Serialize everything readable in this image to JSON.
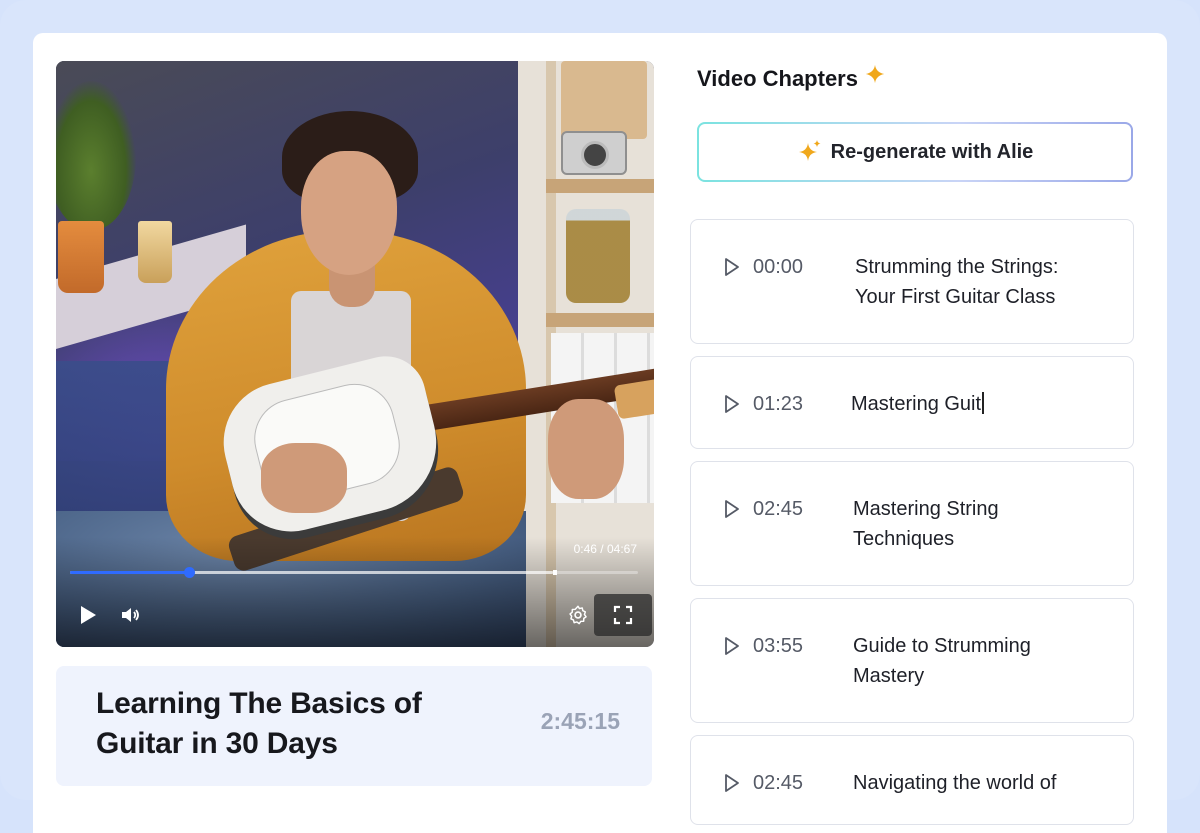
{
  "player": {
    "time_readout": "0:46 / 04:67",
    "progress_fraction": 0.21,
    "buffered_fraction": 0.85
  },
  "video": {
    "title": "Learning The Basics of Guitar in 30 Days",
    "duration": "2:45:15"
  },
  "chapters_panel": {
    "title": "Video Chapters",
    "regenerate_label": "Re-generate with Alie",
    "chapters": [
      {
        "time": "00:00",
        "title": "Strumming the Strings: Your First Guitar Class"
      },
      {
        "time": "01:23",
        "title": "Mastering Guit"
      },
      {
        "time": "02:45",
        "title": "Mastering String Techniques"
      },
      {
        "time": "03:55",
        "title": "Guide to Strumming Mastery"
      },
      {
        "time": "02:45",
        "title": "Navigating the world of"
      }
    ]
  },
  "colors": {
    "accent": "#2f6bff",
    "sparkle": "#f0a81c",
    "panel_bg": "#eff3fd"
  }
}
